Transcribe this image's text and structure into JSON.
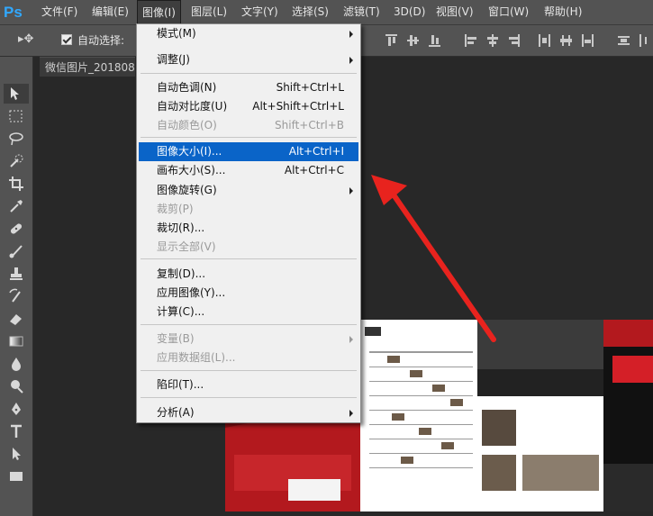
{
  "app": {
    "logo": "Ps",
    "brand_color": "#31a8ff"
  },
  "menubar": {
    "items": [
      "文件(F)",
      "编辑(E)",
      "图像(I)",
      "图层(L)",
      "文字(Y)",
      "选择(S)",
      "滤镜(T)",
      "3D(D)",
      "视图(V)",
      "窗口(W)",
      "帮助(H)"
    ],
    "active": "图像(I)"
  },
  "options_bar": {
    "tool_glyph": "▸✥",
    "auto_select_label": "自动选择:",
    "auto_select_checked": true
  },
  "document": {
    "tab_title": "微信图片_201808"
  },
  "image_menu": {
    "items": [
      {
        "label": "模式(M)",
        "shortcut": "",
        "submenu": true
      },
      {
        "label": "调整(J)",
        "shortcut": "",
        "submenu": true
      },
      {
        "label": "自动色调(N)",
        "shortcut": "Shift+Ctrl+L"
      },
      {
        "label": "自动对比度(U)",
        "shortcut": "Alt+Shift+Ctrl+L"
      },
      {
        "label": "自动颜色(O)",
        "shortcut": "Shift+Ctrl+B",
        "disabled": true
      },
      {
        "label": "图像大小(I)...",
        "shortcut": "Alt+Ctrl+I",
        "highlighted": true
      },
      {
        "label": "画布大小(S)...",
        "shortcut": "Alt+Ctrl+C"
      },
      {
        "label": "图像旋转(G)",
        "shortcut": "",
        "submenu": true
      },
      {
        "label": "裁剪(P)",
        "shortcut": "",
        "disabled": true
      },
      {
        "label": "裁切(R)...",
        "shortcut": ""
      },
      {
        "label": "显示全部(V)",
        "shortcut": "",
        "disabled": true
      },
      {
        "label": "复制(D)...",
        "shortcut": ""
      },
      {
        "label": "应用图像(Y)...",
        "shortcut": ""
      },
      {
        "label": "计算(C)...",
        "shortcut": ""
      },
      {
        "label": "变量(B)",
        "shortcut": "",
        "submenu": true,
        "disabled": true
      },
      {
        "label": "应用数据组(L)...",
        "shortcut": "",
        "disabled": true
      },
      {
        "label": "陷印(T)...",
        "shortcut": ""
      },
      {
        "label": "分析(A)",
        "shortcut": "",
        "submenu": true
      }
    ]
  },
  "colors": {
    "highlight": "#0a64c8",
    "annotation_arrow": "#e8231e"
  }
}
